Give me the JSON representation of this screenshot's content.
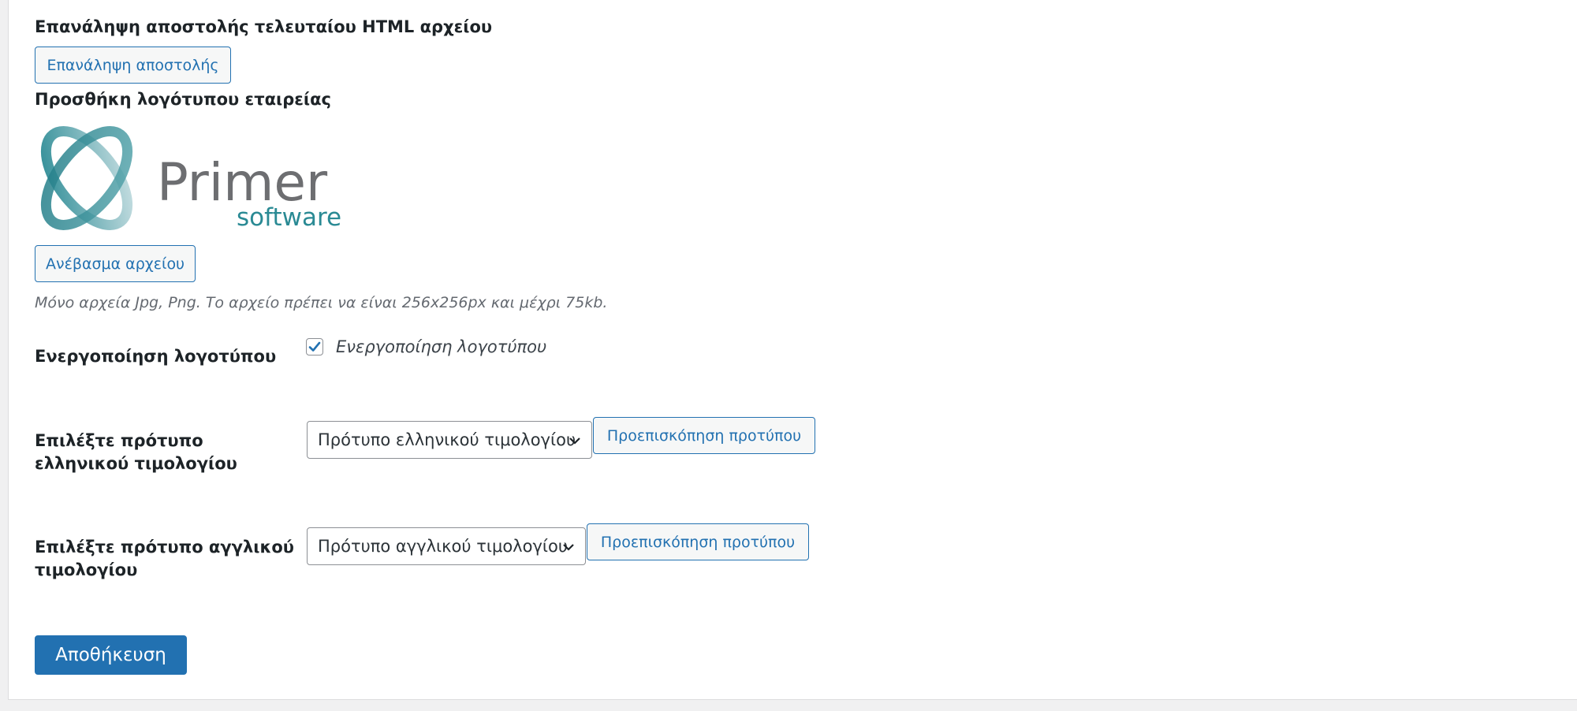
{
  "resend": {
    "heading": "Επανάληψη αποστολής τελευταίου HTML αρχείου",
    "button_label": "Επανάληψη αποστολής"
  },
  "logo": {
    "heading": "Προσθήκη λογότυπου εταιρείας",
    "logo_text_main": "Primer",
    "logo_text_sub": "software",
    "upload_button_label": "Ανέβασμα αρχείου",
    "hint": "Μόνο αρχεία Jpg, Png. Το αρχείο πρέπει να είναι 256x256px και μέχρι 75kb."
  },
  "enable_logo": {
    "label": "Ενεργοποίηση λογοτύπου",
    "checkbox_label": "Ενεργοποίηση λογοτύπου",
    "checked": true
  },
  "greek_template": {
    "label": "Επιλέξτε πρότυπο ελληνικού τιμολογίου",
    "selected": "Πρότυπο ελληνικού τιμολογίου",
    "preview_label": "Προεπισκόπηση προτύπου"
  },
  "english_template": {
    "label": "Επιλέξτε πρότυπο αγγλικού τιμολογίου",
    "selected": "Πρότυπο αγγλικού τιμολογίου",
    "preview_label": "Προεπισκόπηση προτύπου"
  },
  "save": {
    "label": "Αποθήκευση"
  },
  "colors": {
    "accent": "#2271b1",
    "logo_teal": "#2a8a94",
    "logo_gray": "#6d6e71"
  }
}
